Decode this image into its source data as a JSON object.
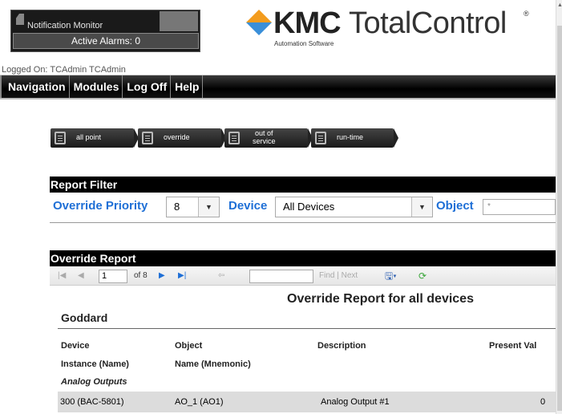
{
  "notification": {
    "title": "Notification Monitor",
    "alarms": "Active Alarms: 0"
  },
  "logo": {
    "brand": "KMC",
    "product": "TotalControl",
    "reg": "®",
    "subtitle": "Automation Software"
  },
  "user": {
    "logged_on": "Logged On: TCAdmin TCAdmin"
  },
  "nav": {
    "items": [
      "Navigation",
      "Modules",
      "Log Off",
      "Help"
    ]
  },
  "report_tabs": [
    {
      "label": "all point"
    },
    {
      "label": "override"
    },
    {
      "label1": "out of",
      "label2": "service"
    },
    {
      "label": "run-time"
    }
  ],
  "filter": {
    "header": "Report Filter",
    "priority_label": "Override Priority",
    "priority_value": "8",
    "device_label": "Device",
    "device_value": "All Devices",
    "object_label": "Object",
    "object_value": "*"
  },
  "report": {
    "header": "Override Report",
    "page": "1",
    "of_pages": "of 8",
    "find_label": "Find | Next",
    "title": "Override Report for all devices",
    "group": "Goddard",
    "columns": {
      "device": "Device",
      "object": "Object",
      "description": "Description",
      "present": "Present Val",
      "instance": "Instance (Name)",
      "name": "Name (Mnemonic)",
      "category": "Analog Outputs"
    },
    "rows": [
      {
        "device": "300 (BAC-5801)",
        "object": "AO_1 (AO1)",
        "description": "Analog Output #1",
        "present": "0"
      }
    ]
  },
  "colors": {
    "accent": "#1e6fd6",
    "header_bg": "#000000",
    "logo_orange": "#f39c1e",
    "logo_blue": "#3a8fd9"
  }
}
